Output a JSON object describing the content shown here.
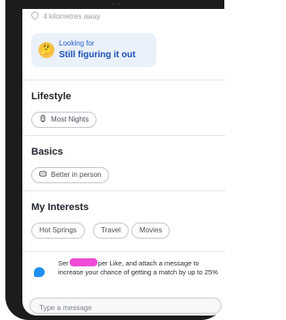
{
  "profile": {
    "distance": "4 kilometres away",
    "looking_for": {
      "label": "Looking for",
      "value": "Still figuring it out",
      "emoji": "🤔"
    },
    "lifestyle": {
      "title": "Lifestyle",
      "chips": [
        {
          "label": "Most Nights",
          "icon": "drink-icon"
        }
      ]
    },
    "basics": {
      "title": "Basics",
      "chips": [
        {
          "label": "Better in person",
          "icon": "chat-icon"
        }
      ]
    },
    "interests": {
      "title": "My Interests",
      "chips": [
        "Hot Springs",
        "Travel",
        "Movies"
      ]
    }
  },
  "promo": {
    "text_start": "Ser",
    "text_end": "per Like, and attach a message to increase your chance of getting a match by up to 25%"
  },
  "message_input": {
    "placeholder": "Type a message",
    "value": ""
  }
}
